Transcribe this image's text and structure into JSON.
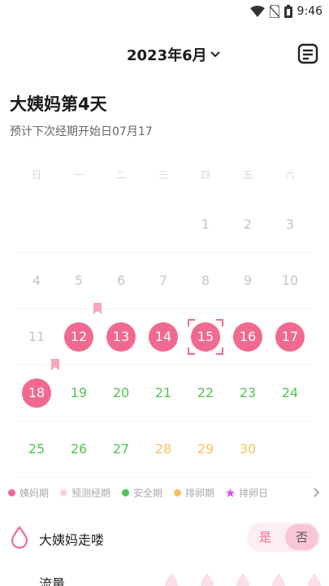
{
  "status_bar": {
    "time": "9:46"
  },
  "header": {
    "month_label": "2023年6月"
  },
  "summary": {
    "title": "大姨妈第4天",
    "subtitle": "预计下次经期开始日07月17"
  },
  "weekdays": [
    "日",
    "一",
    "二",
    "三",
    "四",
    "五",
    "六"
  ],
  "calendar": {
    "rows": [
      [
        {
          "label": "",
          "kind": "empty"
        },
        {
          "label": "",
          "kind": "empty"
        },
        {
          "label": "",
          "kind": "empty"
        },
        {
          "label": "",
          "kind": "empty"
        },
        {
          "label": "1",
          "kind": "normal"
        },
        {
          "label": "2",
          "kind": "normal"
        },
        {
          "label": "3",
          "kind": "normal"
        }
      ],
      [
        {
          "label": "4",
          "kind": "normal"
        },
        {
          "label": "5",
          "kind": "normal"
        },
        {
          "label": "6",
          "kind": "normal"
        },
        {
          "label": "7",
          "kind": "normal"
        },
        {
          "label": "8",
          "kind": "normal"
        },
        {
          "label": "9",
          "kind": "normal"
        },
        {
          "label": "10",
          "kind": "normal"
        }
      ],
      [
        {
          "label": "11",
          "kind": "normal"
        },
        {
          "label": "12",
          "kind": "period",
          "bookmark": true
        },
        {
          "label": "13",
          "kind": "period"
        },
        {
          "label": "14",
          "kind": "period"
        },
        {
          "label": "15",
          "kind": "period",
          "today": true
        },
        {
          "label": "16",
          "kind": "period"
        },
        {
          "label": "17",
          "kind": "period"
        }
      ],
      [
        {
          "label": "18",
          "kind": "period",
          "bookmark": true
        },
        {
          "label": "19",
          "kind": "safe"
        },
        {
          "label": "20",
          "kind": "safe"
        },
        {
          "label": "21",
          "kind": "safe"
        },
        {
          "label": "22",
          "kind": "safe"
        },
        {
          "label": "23",
          "kind": "safe"
        },
        {
          "label": "24",
          "kind": "safe"
        }
      ],
      [
        {
          "label": "25",
          "kind": "safe"
        },
        {
          "label": "26",
          "kind": "safe"
        },
        {
          "label": "27",
          "kind": "safe"
        },
        {
          "label": "28",
          "kind": "ovu"
        },
        {
          "label": "29",
          "kind": "ovu"
        },
        {
          "label": "30",
          "kind": "ovu"
        },
        {
          "label": "",
          "kind": "empty"
        }
      ]
    ]
  },
  "legend": {
    "items": [
      {
        "label": "姨妈期",
        "color": "#f06a8f",
        "shape": "dot"
      },
      {
        "label": "预测经期",
        "color": "#fbd3de",
        "shape": "dot"
      },
      {
        "label": "安全期",
        "color": "#52c452",
        "shape": "dot"
      },
      {
        "label": "排卵期",
        "color": "#f7c25a",
        "shape": "dot"
      },
      {
        "label": "排卵日",
        "color": "#e84df0",
        "shape": "flower"
      }
    ],
    "more_icon": "chevron-right-icon"
  },
  "period_toggle": {
    "label": "大姨妈走喽",
    "yes": "是",
    "no": "否",
    "selected": "否"
  },
  "flow": {
    "label": "流量",
    "level_count": 5
  },
  "colors": {
    "period": "#f06a8f",
    "safe": "#52c452",
    "ovulation": "#f7c25a",
    "predicted": "#fbd3de"
  }
}
